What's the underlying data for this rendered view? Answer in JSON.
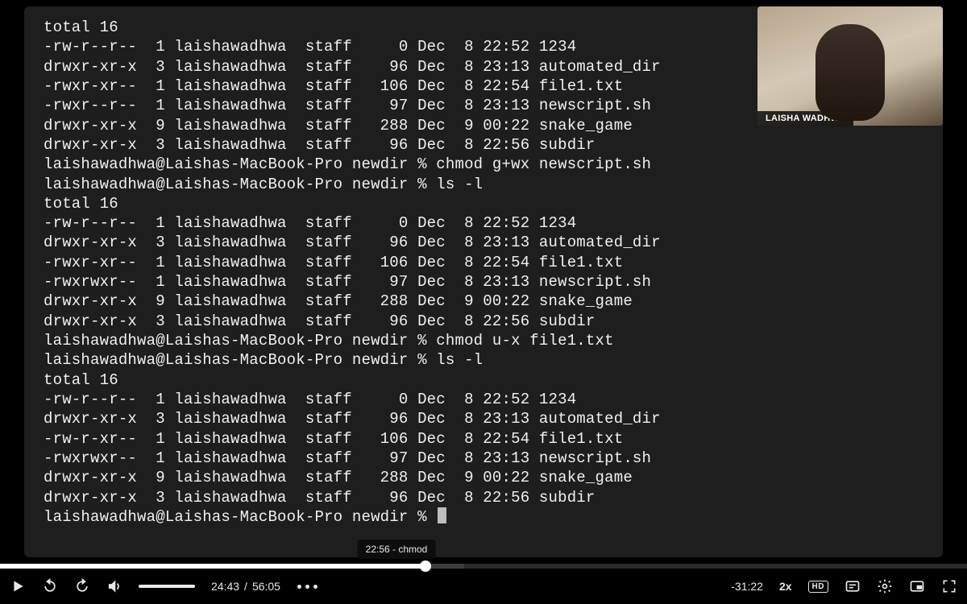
{
  "presenter": {
    "name": "LAISHA WADHWA"
  },
  "prompt": {
    "user": "laishawadhwa",
    "host": "Laishas-MacBook-Pro",
    "cwd": "newdir",
    "symbol": "%"
  },
  "terminal": {
    "total_label": "total 16",
    "commands": {
      "chmod_gwx": "chmod g+wx newscript.sh",
      "ls_l": "ls -l",
      "chmod_ux": "chmod u-x file1.txt"
    },
    "listing1": [
      {
        "perm": "-rw-r--r--",
        "links": "1",
        "owner": "laishawadhwa",
        "group": "staff",
        "size": "0",
        "month": "Dec",
        "day": "8",
        "time": "22:52",
        "name": "1234"
      },
      {
        "perm": "drwxr-xr-x",
        "links": "3",
        "owner": "laishawadhwa",
        "group": "staff",
        "size": "96",
        "month": "Dec",
        "day": "8",
        "time": "23:13",
        "name": "automated_dir"
      },
      {
        "perm": "-rwxr-xr--",
        "links": "1",
        "owner": "laishawadhwa",
        "group": "staff",
        "size": "106",
        "month": "Dec",
        "day": "8",
        "time": "22:54",
        "name": "file1.txt"
      },
      {
        "perm": "-rwxr--r--",
        "links": "1",
        "owner": "laishawadhwa",
        "group": "staff",
        "size": "97",
        "month": "Dec",
        "day": "8",
        "time": "23:13",
        "name": "newscript.sh"
      },
      {
        "perm": "drwxr-xr-x",
        "links": "9",
        "owner": "laishawadhwa",
        "group": "staff",
        "size": "288",
        "month": "Dec",
        "day": "9",
        "time": "00:22",
        "name": "snake_game"
      },
      {
        "perm": "drwxr-xr-x",
        "links": "3",
        "owner": "laishawadhwa",
        "group": "staff",
        "size": "96",
        "month": "Dec",
        "day": "8",
        "time": "22:56",
        "name": "subdir"
      }
    ],
    "listing2": [
      {
        "perm": "-rw-r--r--",
        "links": "1",
        "owner": "laishawadhwa",
        "group": "staff",
        "size": "0",
        "month": "Dec",
        "day": "8",
        "time": "22:52",
        "name": "1234"
      },
      {
        "perm": "drwxr-xr-x",
        "links": "3",
        "owner": "laishawadhwa",
        "group": "staff",
        "size": "96",
        "month": "Dec",
        "day": "8",
        "time": "23:13",
        "name": "automated_dir"
      },
      {
        "perm": "-rwxr-xr--",
        "links": "1",
        "owner": "laishawadhwa",
        "group": "staff",
        "size": "106",
        "month": "Dec",
        "day": "8",
        "time": "22:54",
        "name": "file1.txt"
      },
      {
        "perm": "-rwxrwxr--",
        "links": "1",
        "owner": "laishawadhwa",
        "group": "staff",
        "size": "97",
        "month": "Dec",
        "day": "8",
        "time": "23:13",
        "name": "newscript.sh"
      },
      {
        "perm": "drwxr-xr-x",
        "links": "9",
        "owner": "laishawadhwa",
        "group": "staff",
        "size": "288",
        "month": "Dec",
        "day": "9",
        "time": "00:22",
        "name": "snake_game"
      },
      {
        "perm": "drwxr-xr-x",
        "links": "3",
        "owner": "laishawadhwa",
        "group": "staff",
        "size": "96",
        "month": "Dec",
        "day": "8",
        "time": "22:56",
        "name": "subdir"
      }
    ],
    "listing3": [
      {
        "perm": "-rw-r--r--",
        "links": "1",
        "owner": "laishawadhwa",
        "group": "staff",
        "size": "0",
        "month": "Dec",
        "day": "8",
        "time": "22:52",
        "name": "1234"
      },
      {
        "perm": "drwxr-xr-x",
        "links": "3",
        "owner": "laishawadhwa",
        "group": "staff",
        "size": "96",
        "month": "Dec",
        "day": "8",
        "time": "23:13",
        "name": "automated_dir"
      },
      {
        "perm": "-rw-r-xr--",
        "links": "1",
        "owner": "laishawadhwa",
        "group": "staff",
        "size": "106",
        "month": "Dec",
        "day": "8",
        "time": "22:54",
        "name": "file1.txt"
      },
      {
        "perm": "-rwxrwxr--",
        "links": "1",
        "owner": "laishawadhwa",
        "group": "staff",
        "size": "97",
        "month": "Dec",
        "day": "8",
        "time": "23:13",
        "name": "newscript.sh"
      },
      {
        "perm": "drwxr-xr-x",
        "links": "9",
        "owner": "laishawadhwa",
        "group": "staff",
        "size": "288",
        "month": "Dec",
        "day": "9",
        "time": "00:22",
        "name": "snake_game"
      },
      {
        "perm": "drwxr-xr-x",
        "links": "3",
        "owner": "laishawadhwa",
        "group": "staff",
        "size": "96",
        "month": "Dec",
        "day": "8",
        "time": "22:56",
        "name": "subdir"
      }
    ]
  },
  "player": {
    "elapsed": "24:43",
    "separator": "/",
    "duration": "56:05",
    "remaining": "-31:22",
    "speed": "2x",
    "quality": "HD",
    "played_pct": 44,
    "buffered_pct": 48,
    "chapter_tooltip": "22:56 - chmod",
    "tooltip_pct": 41
  }
}
